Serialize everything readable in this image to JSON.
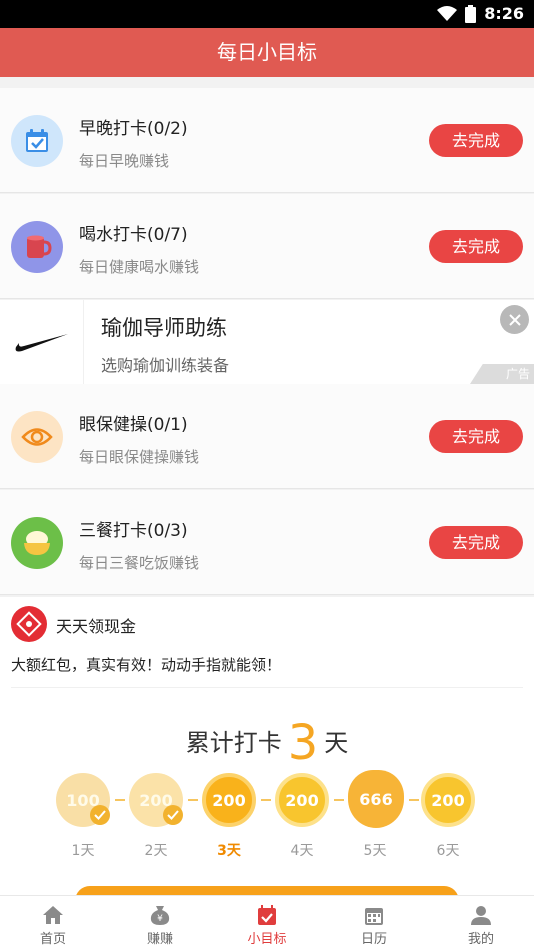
{
  "status": {
    "time": "8:26"
  },
  "header": {
    "title": "每日小目标"
  },
  "tasks": [
    {
      "title": "早晚打卡(0/2)",
      "subtitle": "每日早晚赚钱",
      "button": "去完成",
      "icon": "calendar-check-icon"
    },
    {
      "title": "喝水打卡(0/7)",
      "subtitle": "每日健康喝水赚钱",
      "button": "去完成",
      "icon": "water-cup-icon"
    },
    {
      "title": "眼保健操(0/1)",
      "subtitle": "每日眼保健操赚钱",
      "button": "去完成",
      "icon": "eye-icon"
    },
    {
      "title": "三餐打卡(0/3)",
      "subtitle": "每日三餐吃饭赚钱",
      "button": "去完成",
      "icon": "rice-bowl-icon"
    }
  ],
  "ad": {
    "title": "瑜伽导师助练",
    "subtitle": "选购瑜伽训练装备",
    "tag": "广告",
    "icon": "nike-swoosh-logo"
  },
  "cash": {
    "brand": "天天领现金",
    "desc": "大额红包，真实有效！动动手指就能领！",
    "streak_prefix": "累计打卡",
    "streak_days": "3",
    "streak_suffix": "天",
    "days": [
      {
        "value": "100",
        "label": "1天",
        "checked": true,
        "note": "已签"
      },
      {
        "value": "200",
        "label": "2天",
        "checked": true
      },
      {
        "value": "200",
        "label": "3天",
        "active": true
      },
      {
        "value": "200",
        "label": "4天"
      },
      {
        "value": "666",
        "label": "5天"
      },
      {
        "value": "200",
        "label": "6天"
      }
    ]
  },
  "tabs": [
    {
      "label": "首页",
      "icon": "home-icon"
    },
    {
      "label": "赚赚",
      "icon": "money-bag-icon"
    },
    {
      "label": "小目标",
      "icon": "target-calendar-icon",
      "active": true
    },
    {
      "label": "日历",
      "icon": "calendar-icon"
    },
    {
      "label": "我的",
      "icon": "user-icon"
    }
  ],
  "colors": {
    "header": "#e05a52",
    "button": "#e94544",
    "accent": "#f5a623",
    "tab_active": "#e03d3d"
  }
}
